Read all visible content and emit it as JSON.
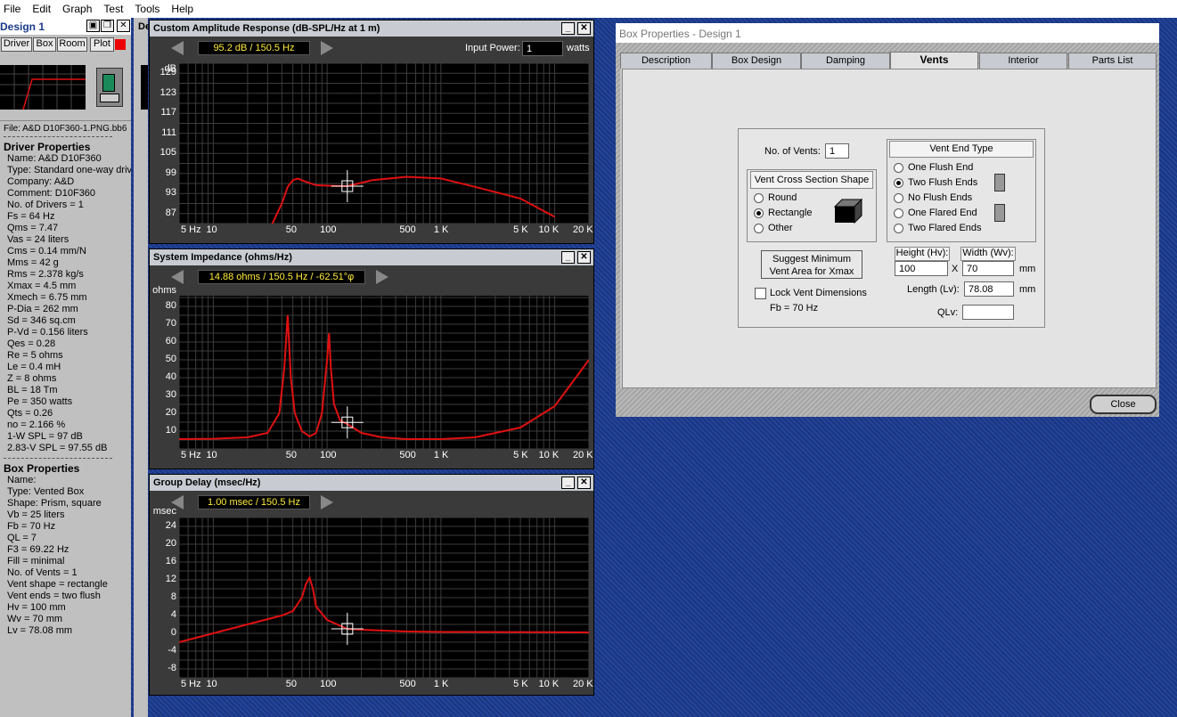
{
  "menu": [
    "File",
    "Edit",
    "Graph",
    "Test",
    "Tools",
    "Help"
  ],
  "left_window": {
    "title": "Design 1",
    "tabs": [
      "Driver",
      "Box",
      "Room",
      "Plot"
    ],
    "file": "File: A&D D10F360-1.PNG.bb6",
    "driver_heading": "Driver Properties",
    "driver_props": [
      "Name: A&D D10F360",
      "Type: Standard one-way driver",
      "Company: A&D",
      "Comment: D10F360",
      "No. of Drivers = 1",
      "Fs = 64 Hz",
      "Qms = 7.47",
      "Vas = 24 liters",
      "Cms = 0.14 mm/N",
      "Mms = 42 g",
      "Rms = 2.378 kg/s",
      "Xmax = 4.5 mm",
      "Xmech = 6.75 mm",
      "P-Dia = 262 mm",
      "Sd = 346 sq.cm",
      "P-Vd = 0.156 liters",
      "Qes = 0.28",
      "Re = 5 ohms",
      "Le = 0.4 mH",
      "Z = 8 ohms",
      "BL = 18 Tm",
      "Pe = 350 watts",
      "Qts = 0.26",
      "no = 2.166 %",
      "1-W SPL = 97 dB",
      "2.83-V SPL = 97.55 dB"
    ],
    "box_heading": "Box Properties",
    "box_props": [
      "Name:",
      "Type: Vented Box",
      "Shape: Prism, square",
      "Vb = 25 liters",
      "Fb = 70 Hz",
      "QL = 7",
      "F3 = 69.22 Hz",
      "Fill = minimal",
      "No. of Vents = 1",
      "Vent shape = rectangle",
      "Vent ends = two flush",
      "Hv = 100 mm",
      "Wv = 70 mm",
      "Lv = 78.08 mm"
    ]
  },
  "second_window_label": "De",
  "amp": {
    "title": "Custom Amplitude Response (dB-SPL/Hz at 1 m)",
    "readout": "95.2 dB / 150.5 Hz",
    "input_power_label": "Input Power:",
    "input_power": "1",
    "unit": "watts",
    "yunit": "dB",
    "yticks": [
      "129",
      "123",
      "117",
      "111",
      "105",
      "99",
      "93",
      "87"
    ],
    "xticks": [
      "5 Hz",
      "10",
      "50",
      "100",
      "500",
      "1 K",
      "5 K",
      "10 K",
      "20 K"
    ]
  },
  "imp": {
    "title": "System Impedance (ohms/Hz)",
    "readout": "14.88 ohms / 150.5 Hz / -62.51°φ",
    "yunit": "ohms",
    "yticks": [
      "80",
      "70",
      "60",
      "50",
      "40",
      "30",
      "20",
      "10"
    ],
    "xticks": [
      "5 Hz",
      "10",
      "50",
      "100",
      "500",
      "1 K",
      "5 K",
      "10 K",
      "20 K"
    ]
  },
  "gd": {
    "title": "Group Delay (msec/Hz)",
    "readout": "1.00 msec / 150.5 Hz",
    "yunit": "msec",
    "yticks": [
      "24",
      "20",
      "16",
      "12",
      "8",
      "4",
      "0",
      "-4",
      "-8"
    ],
    "xticks": [
      "5 Hz",
      "10",
      "50",
      "100",
      "500",
      "1 K",
      "5 K",
      "10 K",
      "20 K"
    ]
  },
  "box": {
    "title": "Box Properties - Design 1",
    "tabs": [
      "Description",
      "Box Design",
      "Damping",
      "Vents",
      "Interior",
      "Parts List"
    ],
    "num_vents_label": "No. of Vents:",
    "num_vents": "1",
    "cross_section_title": "Vent Cross Section Shape",
    "cross_section_options": [
      "Round",
      "Rectangle",
      "Other"
    ],
    "end_type_title": "Vent End Type",
    "end_type_options": [
      "One Flush End",
      "Two Flush Ends",
      "No Flush Ends",
      "One Flared End",
      "Two Flared Ends"
    ],
    "suggest_button": [
      "Suggest Minimum",
      "Vent Area for Xmax"
    ],
    "lock_label": "Lock Vent Dimensions",
    "fb": "Fb = 70 Hz",
    "height_label": "Height (Hv):",
    "height": "100",
    "x": "X",
    "width_label": "Width (Wv):",
    "width": "70",
    "mm": "mm",
    "length_label": "Length (Lv):",
    "length": "78.08",
    "qlv_label": "QLv:",
    "qlv": "",
    "close": "Close"
  },
  "colors": {
    "curve": "#e01010",
    "plot_bg": "#000000",
    "grid": "#3c3c3c"
  }
}
